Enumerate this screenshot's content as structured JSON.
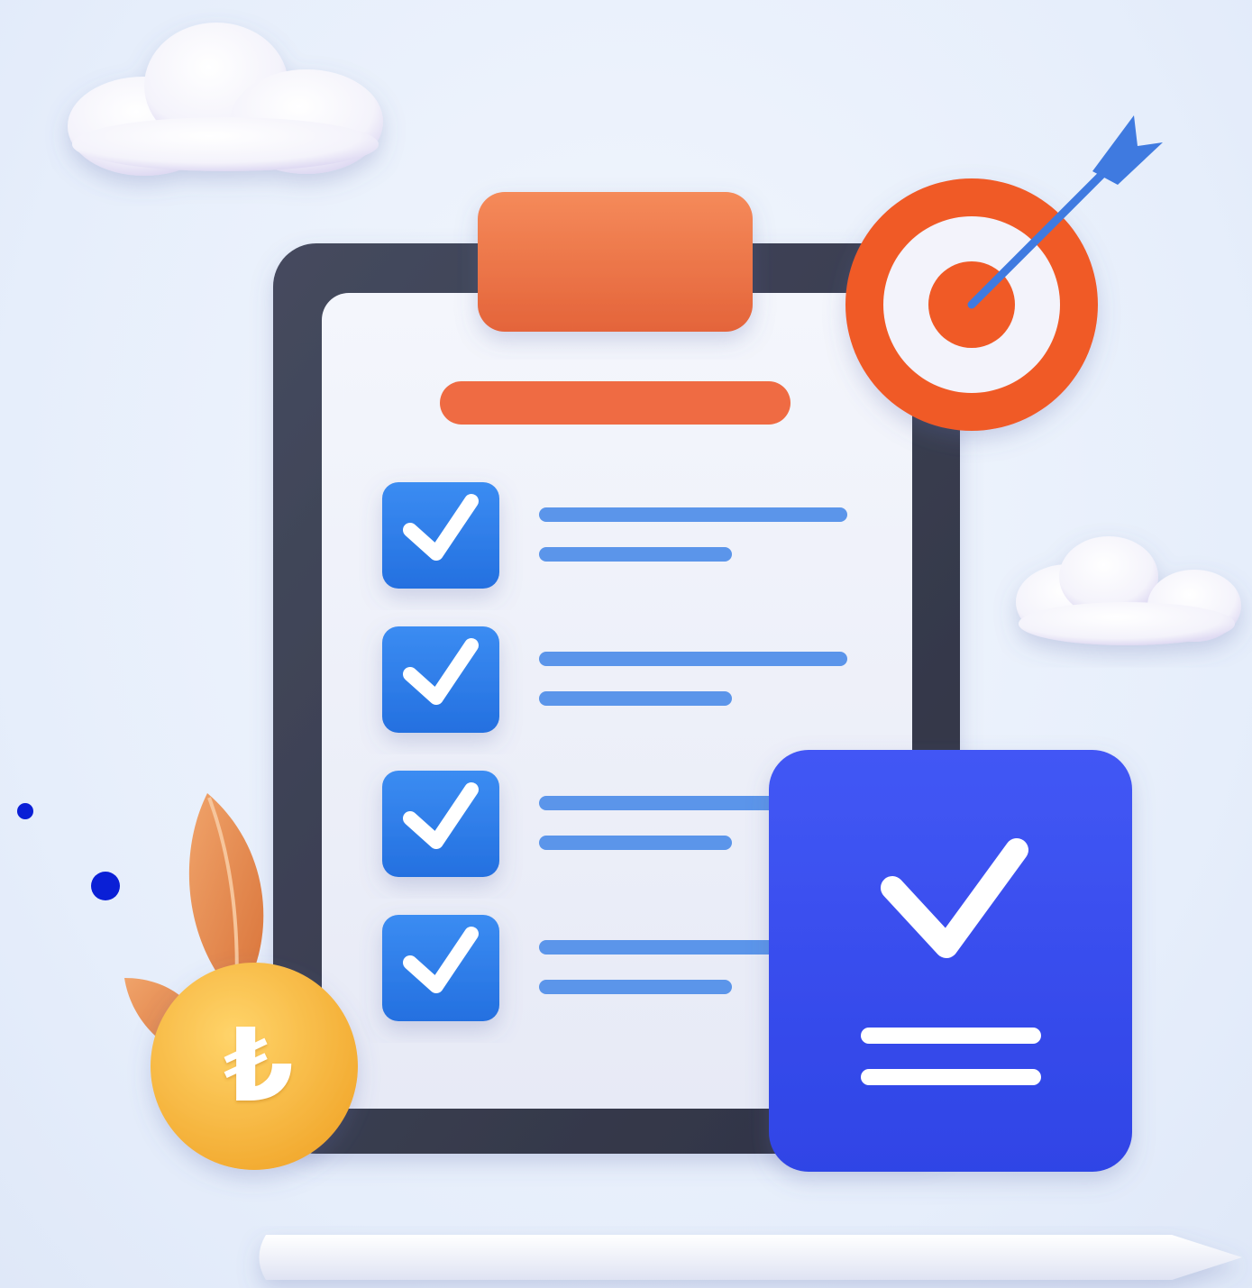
{
  "illustration": {
    "coin": {
      "symbol": "₺"
    },
    "checklist": {
      "items_checked": [
        true,
        true,
        true,
        true
      ]
    },
    "colors": {
      "board_frame": "#3a3d4f",
      "paper": "#eef1fa",
      "clip": "#ef7446",
      "title_bar": "#ef6b43",
      "checkbox": "#2f7fe8",
      "list_line": "#5b95ea",
      "badge": "#3a4ff0",
      "target_ring": "#f05a28",
      "arrow": "#3f7ae0",
      "coin": "#f7b940",
      "leaf": "#e58a4c",
      "dot": "#0a1fd6"
    },
    "icons": [
      "cloud-icon",
      "target-icon",
      "arrow-icon",
      "checkmark-icon",
      "coin-icon",
      "leaf-icon",
      "pencil-icon"
    ]
  }
}
